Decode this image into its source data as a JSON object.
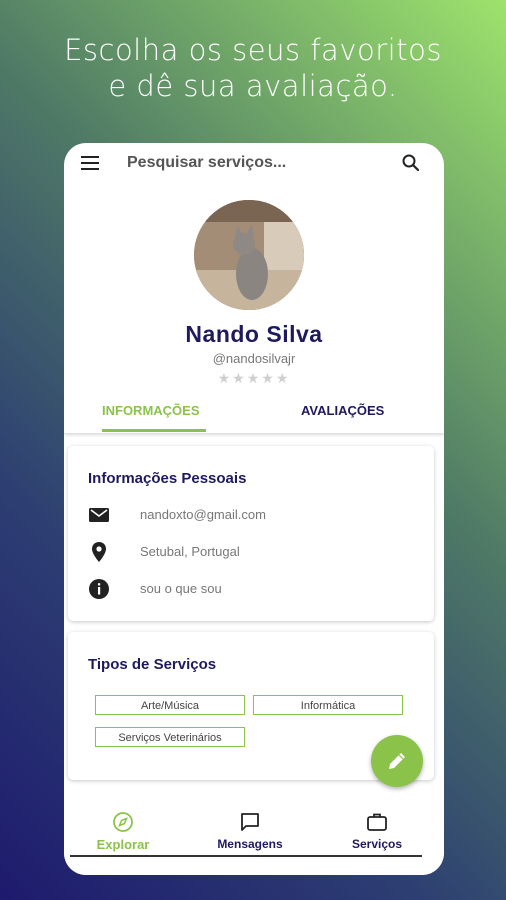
{
  "headline": {
    "line1": "Escolha os seus favoritos",
    "line2": "e dê sua avaliação."
  },
  "topbar": {
    "search_placeholder": "Pesquisar serviços..."
  },
  "profile": {
    "name": "Nando Silva",
    "username": "@nandosilvajr",
    "rating": 0,
    "stars": "★★★★★"
  },
  "tabs": [
    {
      "label": "INFORMAÇÕES",
      "active": true
    },
    {
      "label": "AVALIAÇÕES",
      "active": false
    }
  ],
  "personal": {
    "title": "Informações Pessoais",
    "email": "nandoxto@gmail.com",
    "location": "Setubal, Portugal",
    "about": "sou o que sou"
  },
  "services": {
    "title": "Tipos de Serviços",
    "chips": [
      "Arte/Música",
      "Informática",
      "Serviços Veterinários"
    ]
  },
  "bottom_nav": [
    {
      "label": "Explorar",
      "icon": "compass-icon",
      "active": true
    },
    {
      "label": "Mensagens",
      "icon": "message-icon",
      "active": false
    },
    {
      "label": "Serviços",
      "icon": "briefcase-icon",
      "active": false
    }
  ],
  "colors": {
    "accent": "#8bc34a",
    "primary_text": "#1f1a5e"
  }
}
